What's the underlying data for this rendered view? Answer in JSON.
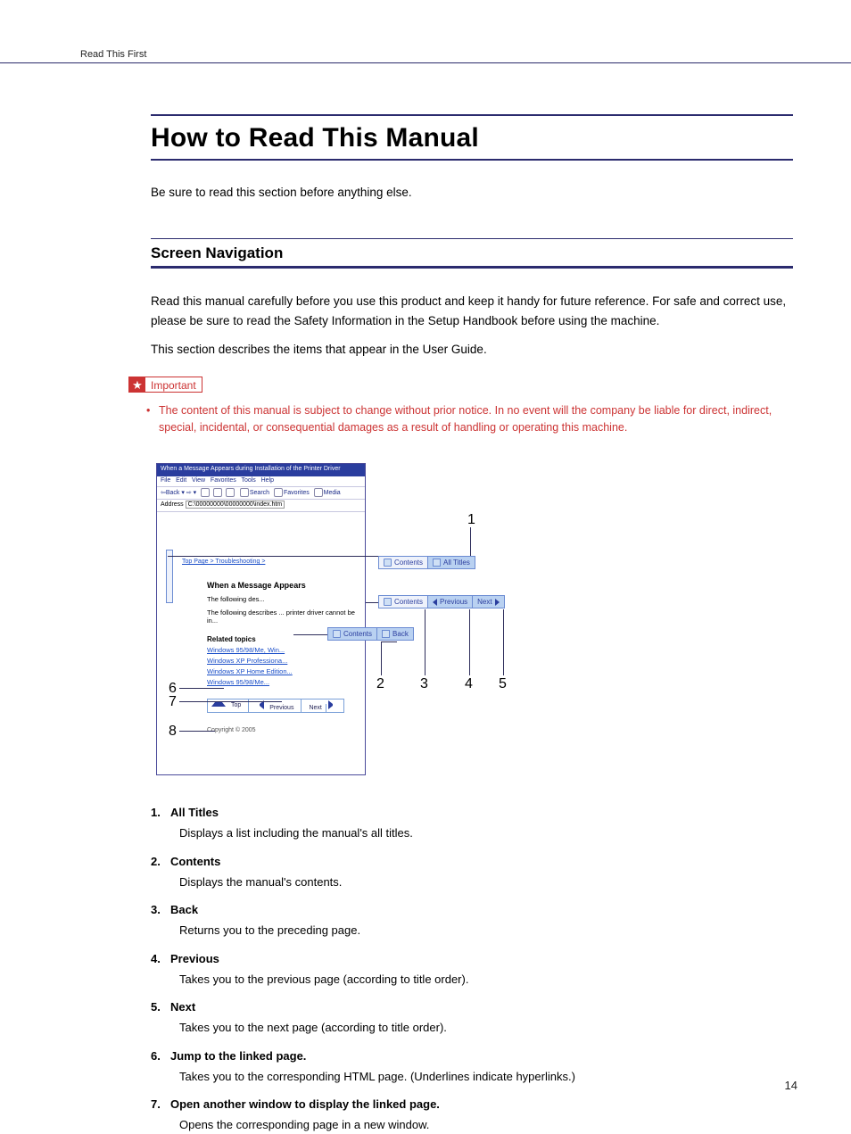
{
  "running_head": "Read This First",
  "title": "How to Read This Manual",
  "intro": "Be sure to read this section before anything else.",
  "subhead": "Screen Navigation",
  "body1": "Read this manual carefully before you use this product and keep it handy for future reference. For safe and correct use, please be sure to read the Safety Information in the Setup Handbook before using the machine.",
  "body2": "This section describes the items that appear in the User Guide.",
  "important": {
    "label": "Important",
    "items": [
      "The content of this manual is subject to change without prior notice. In no event will the company be liable for direct, indirect, special, incidental, or consequential damages as a result of handling or operating this machine."
    ]
  },
  "diagram": {
    "window_title": "When a Message Appears during Installation of the Printer Driver",
    "menus": [
      "File",
      "Edit",
      "View",
      "Favorites",
      "Tools",
      "Help"
    ],
    "toolbar": {
      "back": "Back",
      "search": "Search",
      "favorites": "Favorites",
      "media": "Media"
    },
    "address_label": "Address",
    "address_value": "C:\\00000000\\00000000\\index.htm",
    "breadcrumb": "Top Page > Troubleshooting > ",
    "heading": "When a Message Appears",
    "line1": "The following des...",
    "line2": "The following describes ... printer driver cannot be in...",
    "subhead": "Related topics",
    "links": [
      "Windows 95/98/Me, Win...",
      "Windows XP Professiona...",
      "Windows XP Home Edition...",
      "Windows 95/98/Me..."
    ],
    "bottom_nav": {
      "top": "Top",
      "prev": "Previous",
      "next": "Next"
    },
    "copyright": "Copyright © 2005",
    "panel1": {
      "contents": "Contents",
      "all_titles": "All Titles"
    },
    "panel2": {
      "contents": "Contents",
      "prev": "Previous",
      "next": "Next"
    },
    "panel3": {
      "contents": "Contents",
      "back": "Back"
    },
    "nums": {
      "n1": "1",
      "n2": "2",
      "n3": "3",
      "n4": "4",
      "n5": "5",
      "n6": "6",
      "n7": "7",
      "n8": "8"
    }
  },
  "defs": [
    {
      "n": "1.",
      "t": "All Titles",
      "d": "Displays a list including the manual's all titles."
    },
    {
      "n": "2.",
      "t": "Contents",
      "d": "Displays the manual's contents."
    },
    {
      "n": "3.",
      "t": "Back",
      "d": "Returns you to the preceding page."
    },
    {
      "n": "4.",
      "t": "Previous",
      "d": "Takes you to the previous page (according to title order)."
    },
    {
      "n": "5.",
      "t": "Next",
      "d": "Takes you to the next page (according to title order)."
    },
    {
      "n": "6.",
      "t": "Jump to the linked page.",
      "d": "Takes you to the corresponding HTML page. (Underlines indicate hyperlinks.)"
    },
    {
      "n": "7.",
      "t": "Open another window to display the linked page.",
      "d": "Opens the corresponding page in a new window."
    }
  ],
  "page_number": "14"
}
